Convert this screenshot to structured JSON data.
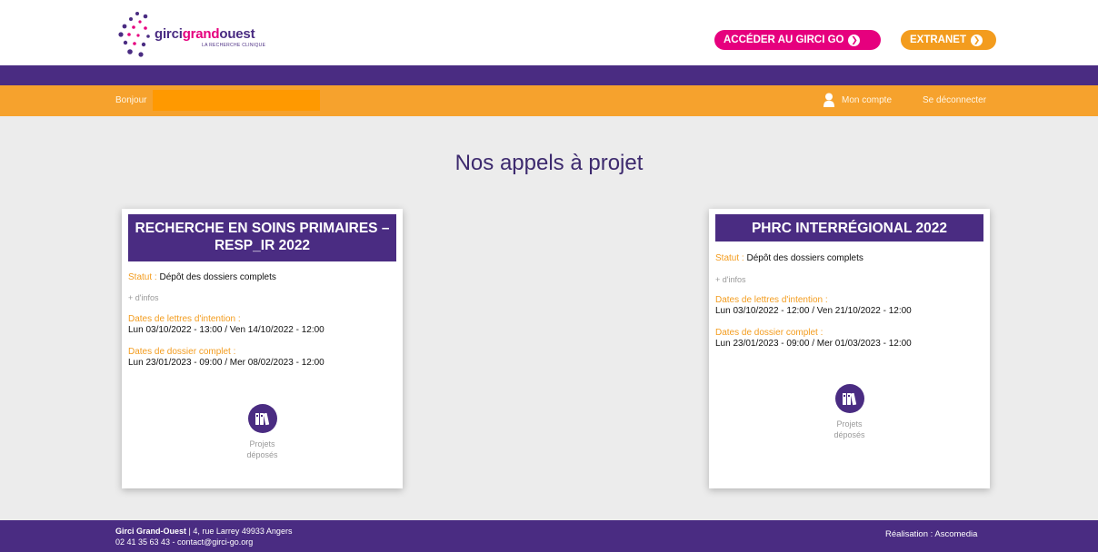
{
  "header": {
    "logo": {
      "part1": "girci",
      "part2": "grand",
      "part3": "ouest",
      "subtitle": "LA RECHERCHE CLINIQUE"
    },
    "buttons": {
      "girci_go": "ACCÉDER AU GIRCI GO",
      "extranet": "EXTRANET"
    }
  },
  "userbar": {
    "greeting": "Bonjour",
    "account": "Mon compte",
    "logout": "Se déconnecter"
  },
  "main": {
    "title": "Nos appels à projet",
    "cards": [
      {
        "title": "RECHERCHE EN SOINS PRIMAIRES – RESP_IR 2022",
        "status_label": "Statut :",
        "status_value": "Dépôt des dossiers complets",
        "more_info": "+ d'infos",
        "intent_label": "Dates de lettres d'intention :",
        "intent_value": "Lun 03/10/2022 - 13:00 / Ven 14/10/2022 - 12:00",
        "complete_label": "Dates de dossier complet :",
        "complete_value": "Lun 23/01/2023 - 09:00 / Mer 08/02/2023 - 12:00",
        "projects_label": "Projets déposés"
      },
      {
        "title": "PHRC INTERRÉGIONAL 2022",
        "status_label": "Statut :",
        "status_value": "Dépôt des dossiers complets",
        "more_info": "+ d'infos",
        "intent_label": "Dates de lettres d'intention :",
        "intent_value": "Lun 03/10/2022 - 12:00 / Ven 21/10/2022 - 12:00",
        "complete_label": "Dates de dossier complet :",
        "complete_value": "Lun 23/01/2023 - 09:00 / Mer 01/03/2023 - 12:00",
        "projects_label": "Projets déposés"
      }
    ]
  },
  "footer": {
    "org": "Girci Grand-Ouest",
    "address": " | 4, rue Larrey 49933 Angers",
    "contact": "02 41 35 63 43 - contact@girci-go.org",
    "credit": "Réalisation : Ascomedia"
  },
  "colors": {
    "purple": "#4a2c82",
    "orange": "#f6a22d",
    "magenta": "#e6007e"
  }
}
